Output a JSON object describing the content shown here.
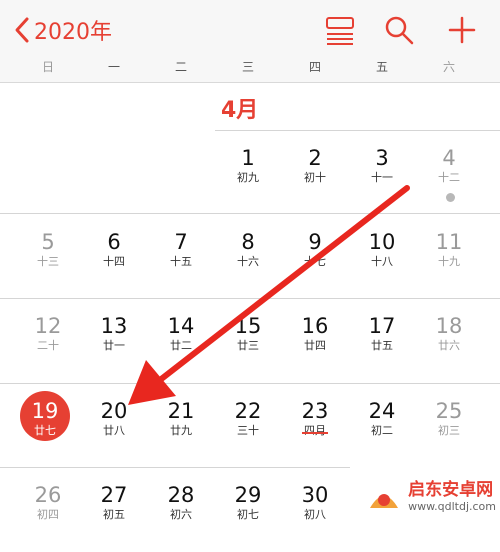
{
  "header": {
    "back_label": "2020年",
    "accent_color": "#e64033",
    "icons": [
      "list-view-icon",
      "search-icon",
      "add-icon"
    ]
  },
  "weekdays": [
    "日",
    "一",
    "二",
    "三",
    "四",
    "五",
    "六"
  ],
  "month_title": "4月",
  "weeks": [
    [
      {
        "num": "",
        "lunar": ""
      },
      {
        "num": "",
        "lunar": ""
      },
      {
        "num": "",
        "lunar": ""
      },
      {
        "num": "1",
        "lunar": "初九"
      },
      {
        "num": "2",
        "lunar": "初十"
      },
      {
        "num": "3",
        "lunar": "十一"
      },
      {
        "num": "4",
        "lunar": "十二"
      }
    ],
    [
      {
        "num": "5",
        "lunar": "十三"
      },
      {
        "num": "6",
        "lunar": "十四"
      },
      {
        "num": "7",
        "lunar": "十五"
      },
      {
        "num": "8",
        "lunar": "十六"
      },
      {
        "num": "9",
        "lunar": "十七"
      },
      {
        "num": "10",
        "lunar": "十八"
      },
      {
        "num": "11",
        "lunar": "十九"
      }
    ],
    [
      {
        "num": "12",
        "lunar": "二十"
      },
      {
        "num": "13",
        "lunar": "廿一"
      },
      {
        "num": "14",
        "lunar": "廿二"
      },
      {
        "num": "15",
        "lunar": "廿三"
      },
      {
        "num": "16",
        "lunar": "廿四"
      },
      {
        "num": "17",
        "lunar": "廿五"
      },
      {
        "num": "18",
        "lunar": "廿六"
      }
    ],
    [
      {
        "num": "19",
        "lunar": "廿七"
      },
      {
        "num": "20",
        "lunar": "廿八"
      },
      {
        "num": "21",
        "lunar": "廿九"
      },
      {
        "num": "22",
        "lunar": "三十"
      },
      {
        "num": "23",
        "lunar": "四月"
      },
      {
        "num": "24",
        "lunar": "初二"
      },
      {
        "num": "25",
        "lunar": "初三"
      }
    ],
    [
      {
        "num": "26",
        "lunar": "初四"
      },
      {
        "num": "27",
        "lunar": "初五"
      },
      {
        "num": "28",
        "lunar": "初六"
      },
      {
        "num": "29",
        "lunar": "初七"
      },
      {
        "num": "30",
        "lunar": "初八"
      },
      {
        "num": "",
        "lunar": ""
      },
      {
        "num": "",
        "lunar": ""
      }
    ]
  ],
  "today": "19",
  "watermark": {
    "title": "启东安卓网",
    "url": "www.qdltdj.com"
  }
}
